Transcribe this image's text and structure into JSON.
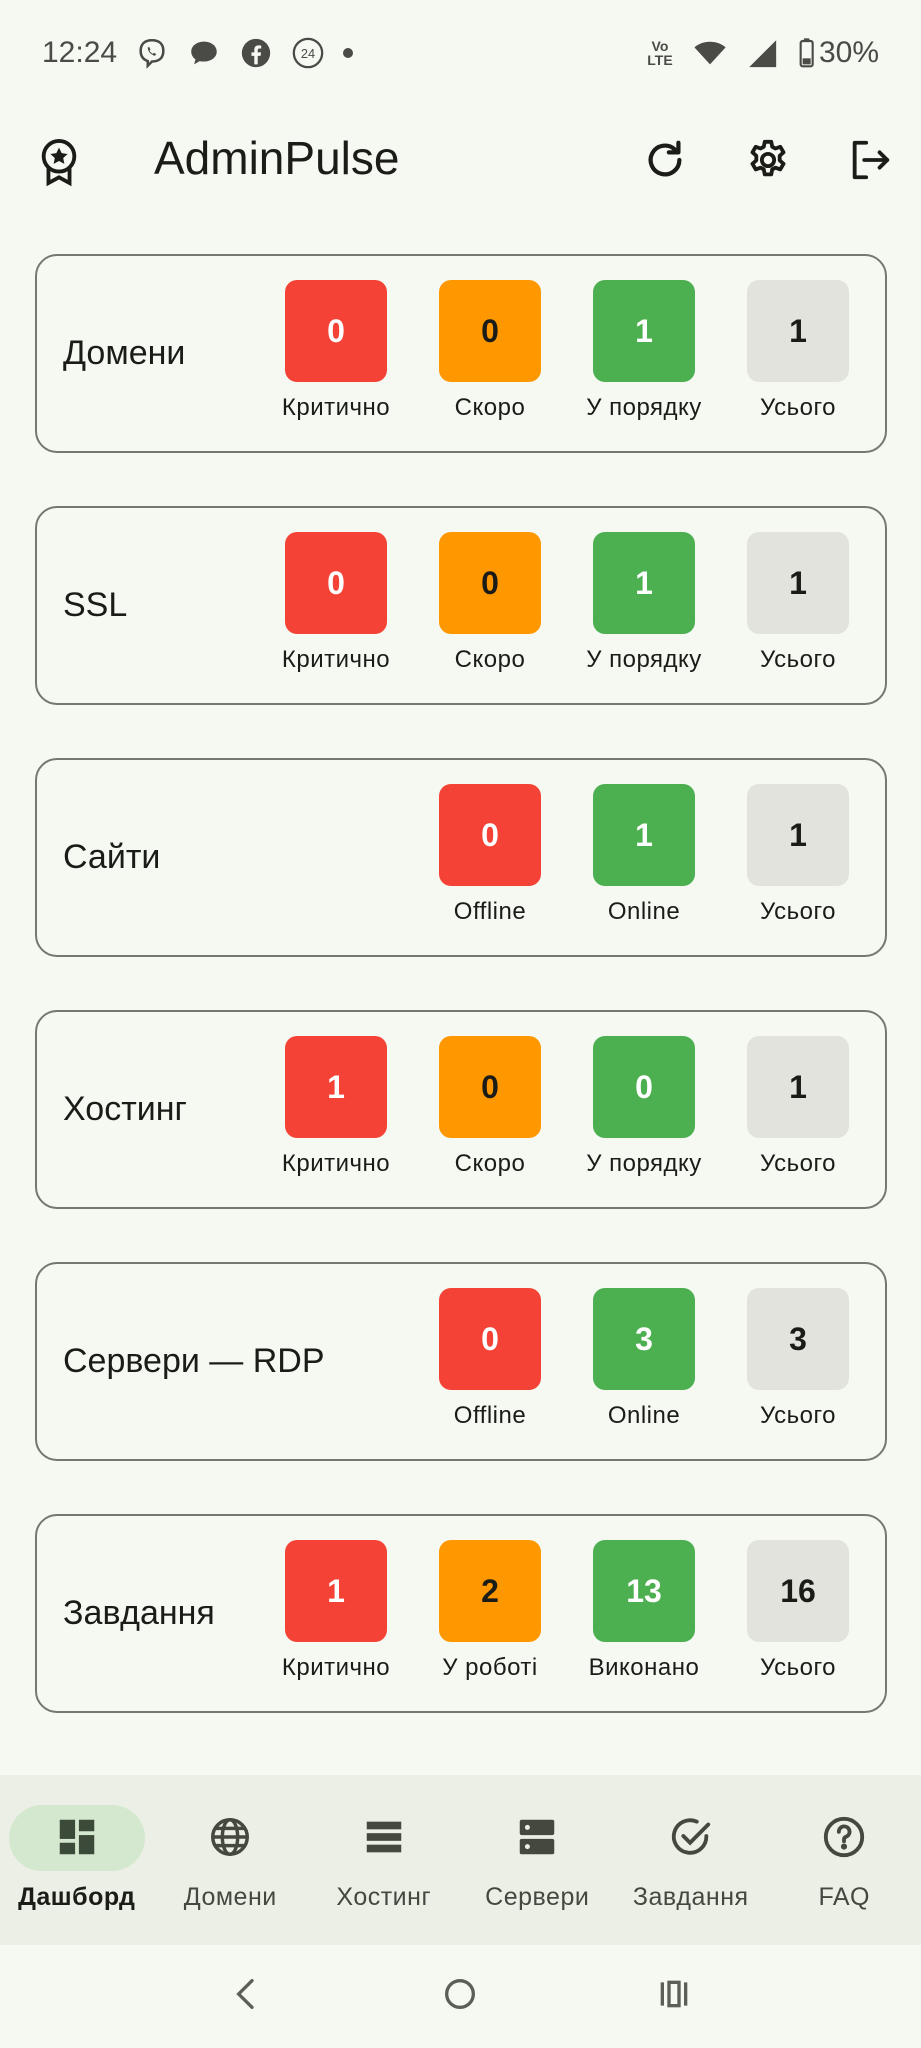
{
  "status_bar": {
    "time": "12:24",
    "battery": "30%",
    "volte": "Vo LTE",
    "icons": [
      "viber-icon",
      "chat-icon",
      "facebook-icon",
      "24-icon",
      "dot-icon",
      "wifi-icon",
      "signal-icon",
      "battery-icon"
    ]
  },
  "app_bar": {
    "title": "AdminPulse",
    "logo_icon": "award-icon",
    "actions": [
      "refresh-icon",
      "settings-icon",
      "logout-icon"
    ]
  },
  "cards": [
    {
      "title": "Домени",
      "stats": [
        {
          "value": "0",
          "label": "Критично",
          "color": "#F44336"
        },
        {
          "value": "0",
          "label": "Скоро",
          "color": "#FF9800"
        },
        {
          "value": "1",
          "label": "У порядку",
          "color": "#4CAF50"
        },
        {
          "value": "1",
          "label": "Усього",
          "color": "#E2E3DC"
        }
      ]
    },
    {
      "title": "SSL",
      "stats": [
        {
          "value": "0",
          "label": "Критично",
          "color": "#F44336"
        },
        {
          "value": "0",
          "label": "Скоро",
          "color": "#FF9800"
        },
        {
          "value": "1",
          "label": "У порядку",
          "color": "#4CAF50"
        },
        {
          "value": "1",
          "label": "Усього",
          "color": "#E2E3DC"
        }
      ]
    },
    {
      "title": "Сайти",
      "stats": [
        {
          "value": "0",
          "label": "Offline",
          "color": "#F44336"
        },
        {
          "value": "1",
          "label": "Online",
          "color": "#4CAF50"
        },
        {
          "value": "1",
          "label": "Усього",
          "color": "#E2E3DC"
        }
      ]
    },
    {
      "title": "Хостинг",
      "stats": [
        {
          "value": "1",
          "label": "Критично",
          "color": "#F44336"
        },
        {
          "value": "0",
          "label": "Скоро",
          "color": "#FF9800"
        },
        {
          "value": "0",
          "label": "У порядку",
          "color": "#4CAF50"
        },
        {
          "value": "1",
          "label": "Усього",
          "color": "#E2E3DC"
        }
      ]
    },
    {
      "title": "Сервери — RDP",
      "stats": [
        {
          "value": "0",
          "label": "Offline",
          "color": "#F44336"
        },
        {
          "value": "3",
          "label": "Online",
          "color": "#4CAF50"
        },
        {
          "value": "3",
          "label": "Усього",
          "color": "#E2E3DC"
        }
      ]
    },
    {
      "title": "Завдання",
      "stats": [
        {
          "value": "1",
          "label": "Критично",
          "color": "#F44336"
        },
        {
          "value": "2",
          "label": "У роботі",
          "color": "#FF9800"
        },
        {
          "value": "13",
          "label": "Виконано",
          "color": "#4CAF50"
        },
        {
          "value": "16",
          "label": "Усього",
          "color": "#E2E3DC"
        }
      ]
    }
  ],
  "bottom_nav": {
    "items": [
      {
        "label": "Дашборд",
        "icon": "dashboard-icon",
        "active": true
      },
      {
        "label": "Домени",
        "icon": "globe-icon",
        "active": false
      },
      {
        "label": "Хостинг",
        "icon": "list-icon",
        "active": false
      },
      {
        "label": "Сервери",
        "icon": "server-icon",
        "active": false
      },
      {
        "label": "Завдання",
        "icon": "check-circle-icon",
        "active": false
      },
      {
        "label": "FAQ",
        "icon": "help-icon",
        "active": false
      }
    ]
  },
  "system_nav": [
    "back-icon",
    "home-icon",
    "recents-icon"
  ],
  "colors": {
    "background": "#F6F9F2",
    "critical": "#F44336",
    "warning": "#FF9800",
    "ok": "#4CAF50",
    "total": "#E2E3DC",
    "nav_active_pill": "#D4E8CF"
  }
}
